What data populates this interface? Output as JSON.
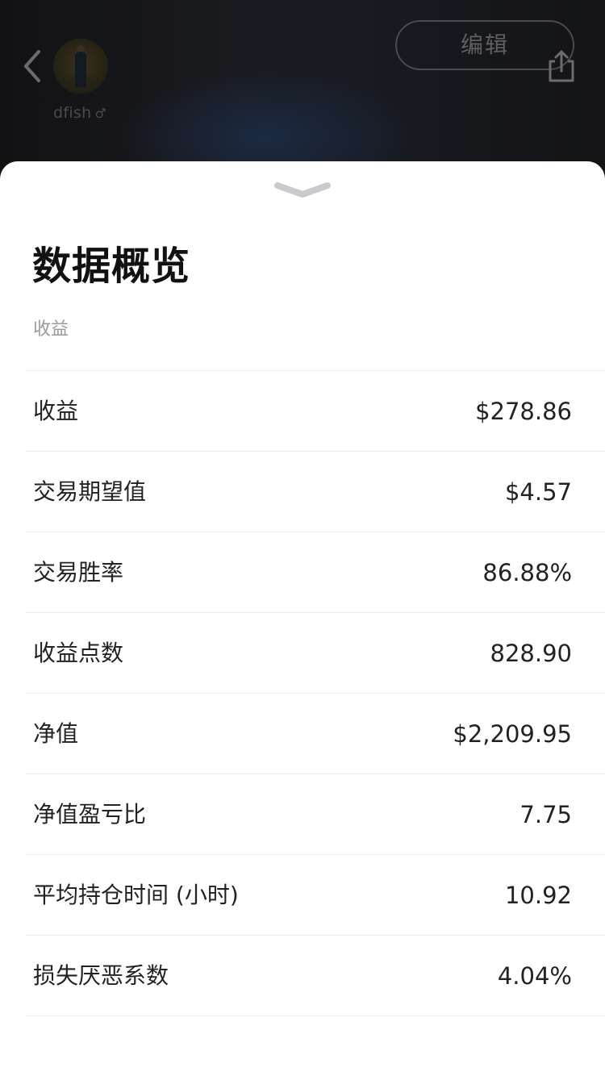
{
  "header": {
    "username": "dfish",
    "gender_symbol": "♂",
    "edit_label": "编辑"
  },
  "overview": {
    "title": "数据概览",
    "section_label": "收益",
    "rows": [
      {
        "label": "收益",
        "value": "$278.86"
      },
      {
        "label": "交易期望值",
        "value": "$4.57"
      },
      {
        "label": "交易胜率",
        "value": "86.88%"
      },
      {
        "label": "收益点数",
        "value": "828.90"
      },
      {
        "label": "净值",
        "value": "$2,209.95"
      },
      {
        "label": "净值盈亏比",
        "value": "7.75"
      },
      {
        "label": "平均持仓时间 (小时)",
        "value": "10.92"
      },
      {
        "label": "损失厌恶系数",
        "value": "4.04%"
      }
    ]
  },
  "icons": {
    "back": "chevron-left-icon",
    "share": "share-icon",
    "collapse": "chevron-down-icon",
    "gender": "male-icon"
  },
  "colors": {
    "sheet_background": "#ffffff",
    "header_background": "#16171b",
    "text_primary": "#222222",
    "text_secondary": "#9a9a9e",
    "divider": "#ececee",
    "handle": "#c9c9ce"
  }
}
